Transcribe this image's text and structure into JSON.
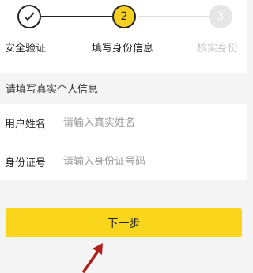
{
  "stepper": {
    "steps": [
      {
        "number": "",
        "label": "安全验证",
        "state": "completed",
        "icon": "check-icon"
      },
      {
        "number": "2",
        "label": "填写身份信息",
        "state": "active"
      },
      {
        "number": "3",
        "label": "核实身份",
        "state": "pending"
      }
    ]
  },
  "section_title": "请填写真实个人信息",
  "form": {
    "name": {
      "label": "用户姓名",
      "placeholder": "请输入真实姓名",
      "value": ""
    },
    "id_number": {
      "label": "身份证号",
      "placeholder": "请输入身份证号码",
      "value": ""
    }
  },
  "next_button": {
    "label": "下一步"
  },
  "colors": {
    "accent": "#f9d51b",
    "annotation_arrow": "#b01e1e",
    "pending": "#e6e6e6"
  }
}
